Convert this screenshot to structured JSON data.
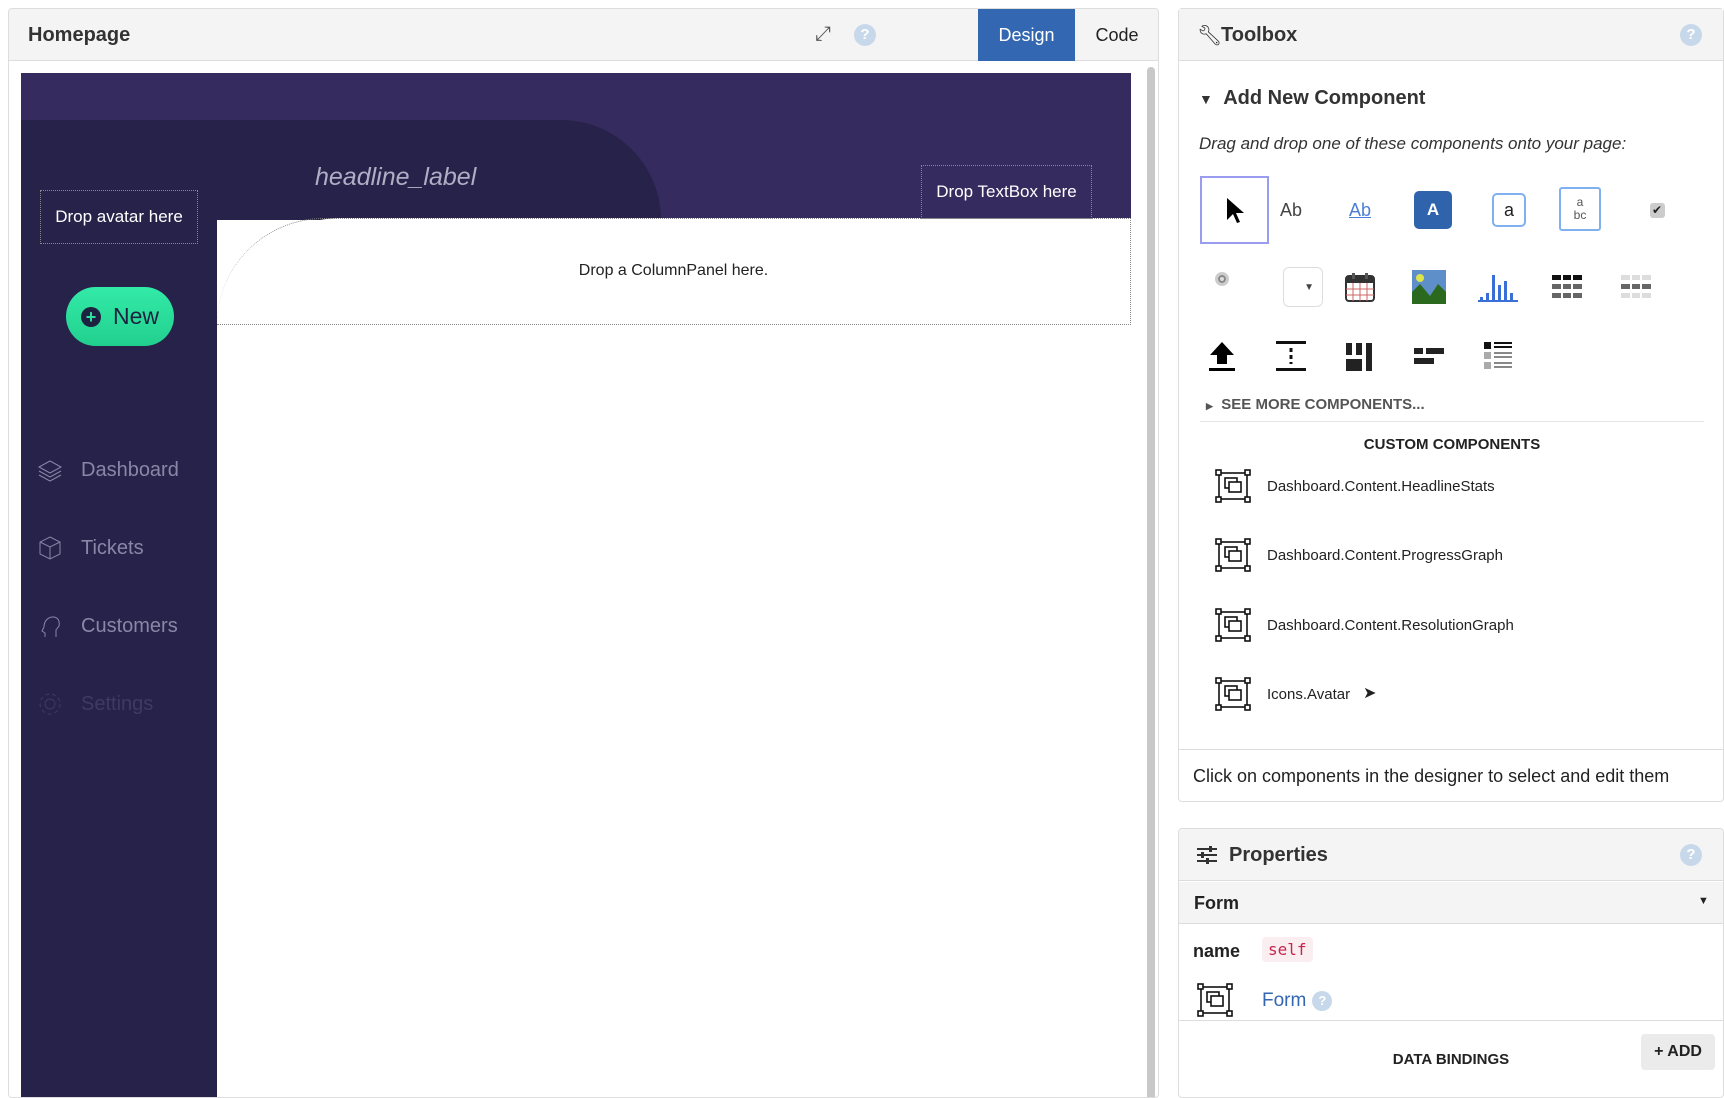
{
  "designer": {
    "title": "Homepage",
    "tabs": [
      {
        "label": "Design",
        "active": true
      },
      {
        "label": "Code",
        "active": false
      }
    ]
  },
  "canvas": {
    "headline": "headline_label",
    "drop_avatar": "Drop avatar here",
    "drop_textbox": "Drop TextBox here",
    "drop_columnpanel": "Drop a ColumnPanel here.",
    "new_button": "New",
    "nav": [
      {
        "label": "Dashboard",
        "icon": "layers-icon"
      },
      {
        "label": "Tickets",
        "icon": "box-icon"
      },
      {
        "label": "Customers",
        "icon": "head-icon"
      },
      {
        "label": "Settings",
        "icon": "gear-icon"
      }
    ]
  },
  "toolbox": {
    "title": "Toolbox",
    "section": "Add New Component",
    "description": "Drag and drop one of these components onto your page:",
    "see_more": "SEE MORE COMPONENTS...",
    "custom_header": "CUSTOM COMPONENTS",
    "custom": [
      "Dashboard.Content.HeadlineStats",
      "Dashboard.Content.ProgressGraph",
      "Dashboard.Content.ResolutionGraph",
      "Icons.Avatar"
    ],
    "footer": "Click on components in the designer to select and edit them",
    "icon_labels": {
      "label": "Ab",
      "link": "Ab",
      "button": "A",
      "textbox": "a",
      "textarea_a": "a",
      "textarea_bc": "bc"
    }
  },
  "properties": {
    "title": "Properties",
    "component": "Form",
    "name_label": "name",
    "name_value": "self",
    "form_link": "Form",
    "data_bindings": "DATA BINDINGS",
    "add": "+ ADD"
  },
  "colors": {
    "accent": "#3367b1",
    "purple": "#352b5e",
    "dark_purple": "#27224a",
    "green": "#2de0a0"
  }
}
